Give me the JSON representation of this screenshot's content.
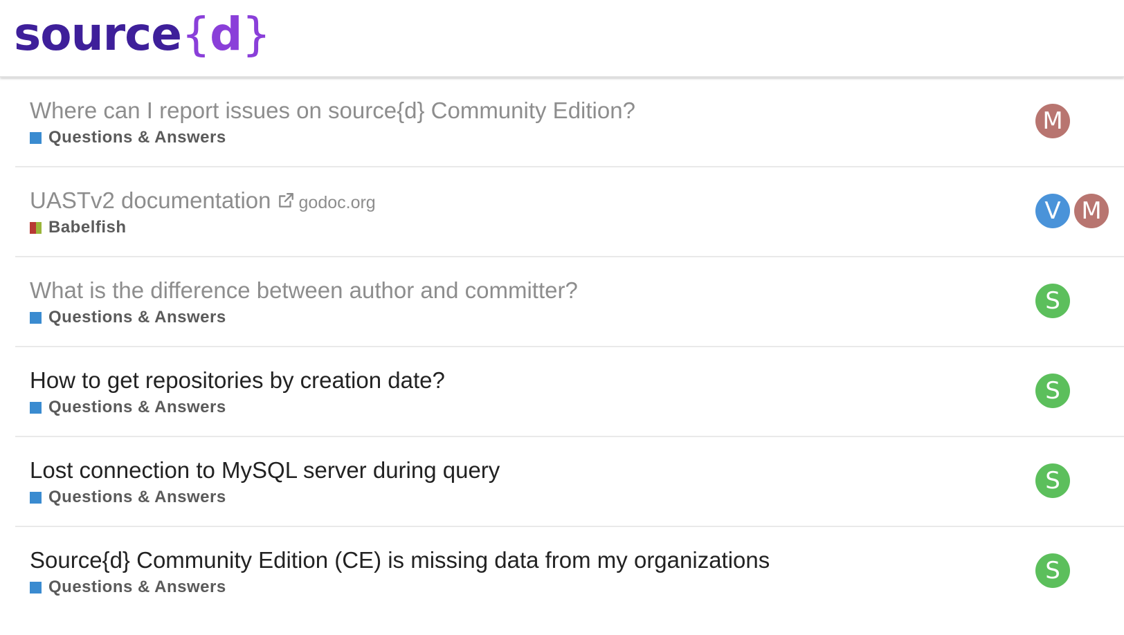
{
  "logo": {
    "word": "source",
    "open_brace": "{",
    "letter": "d",
    "close_brace": "}"
  },
  "colors": {
    "logo_word": "#3e1f9a",
    "logo_accent": "#8a3fd9",
    "category_qa": "#3a8bd0",
    "babelfish_red": "#b83a35",
    "babelfish_green": "#9ab53a"
  },
  "topics": [
    {
      "title": "Where can I report issues on source{d} Community Edition?",
      "visited": true,
      "category": "Questions & Answers",
      "category_colors": [
        "#3a8bd0"
      ],
      "posters": [
        {
          "letter": "M",
          "color": "#b87570"
        }
      ]
    },
    {
      "title": "UASTv2 documentation",
      "visited": true,
      "external_icon": "external-link-icon",
      "external_domain": "godoc.org",
      "category": "Babelfish",
      "category_colors": [
        "#b83a35",
        "#9ab53a"
      ],
      "posters": [
        {
          "letter": "V",
          "color": "#4a93d9"
        },
        {
          "letter": "M",
          "color": "#b87570"
        }
      ]
    },
    {
      "title": "What is the difference between author and committer?",
      "visited": true,
      "category": "Questions & Answers",
      "category_colors": [
        "#3a8bd0"
      ],
      "posters": [
        {
          "letter": "S",
          "color": "#5cbf5c"
        }
      ]
    },
    {
      "title": "How to get repositories by creation date?",
      "visited": false,
      "category": "Questions & Answers",
      "category_colors": [
        "#3a8bd0"
      ],
      "posters": [
        {
          "letter": "S",
          "color": "#5cbf5c"
        }
      ]
    },
    {
      "title": "Lost connection to MySQL server during query",
      "visited": false,
      "category": "Questions & Answers",
      "category_colors": [
        "#3a8bd0"
      ],
      "posters": [
        {
          "letter": "S",
          "color": "#5cbf5c"
        }
      ]
    },
    {
      "title": "Source{d} Community Edition (CE) is missing data from my organizations",
      "visited": false,
      "category": "Questions & Answers",
      "category_colors": [
        "#3a8bd0"
      ],
      "posters": [
        {
          "letter": "S",
          "color": "#5cbf5c"
        }
      ]
    }
  ]
}
